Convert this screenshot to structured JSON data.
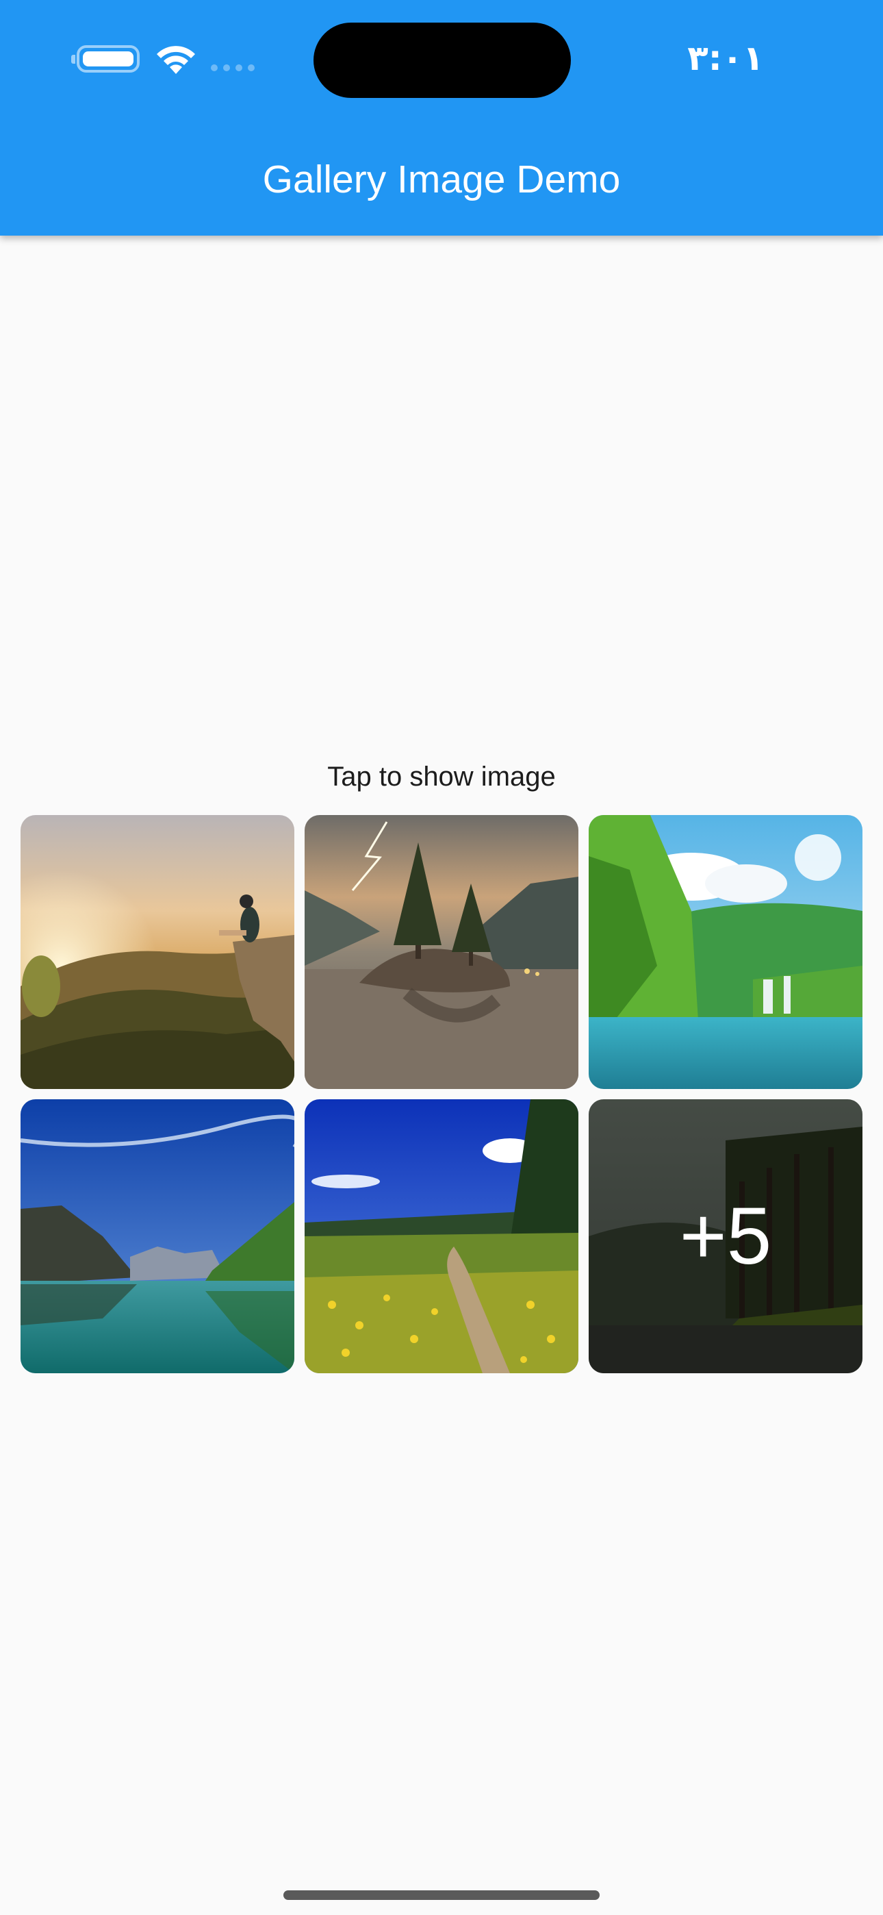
{
  "status_bar": {
    "time": "٣:٠١",
    "icons": [
      "battery-icon",
      "wifi-icon",
      "cellular-signal-icon"
    ]
  },
  "app_bar": {
    "title": "Gallery Image Demo",
    "color": "#2196f3"
  },
  "gallery": {
    "hint": "Tap to show image",
    "images": [
      {
        "name": "sunset-cliff-image"
      },
      {
        "name": "lightning-island-image"
      },
      {
        "name": "waterfall-lake-image"
      },
      {
        "name": "mountain-lake-image"
      },
      {
        "name": "flower-meadow-path-image"
      },
      {
        "name": "forest-lake-image"
      }
    ],
    "more_count_label": "+5"
  },
  "colors": {
    "background": "#fafafa",
    "app_bar": "#2196f3",
    "title_text": "#ffffff"
  }
}
